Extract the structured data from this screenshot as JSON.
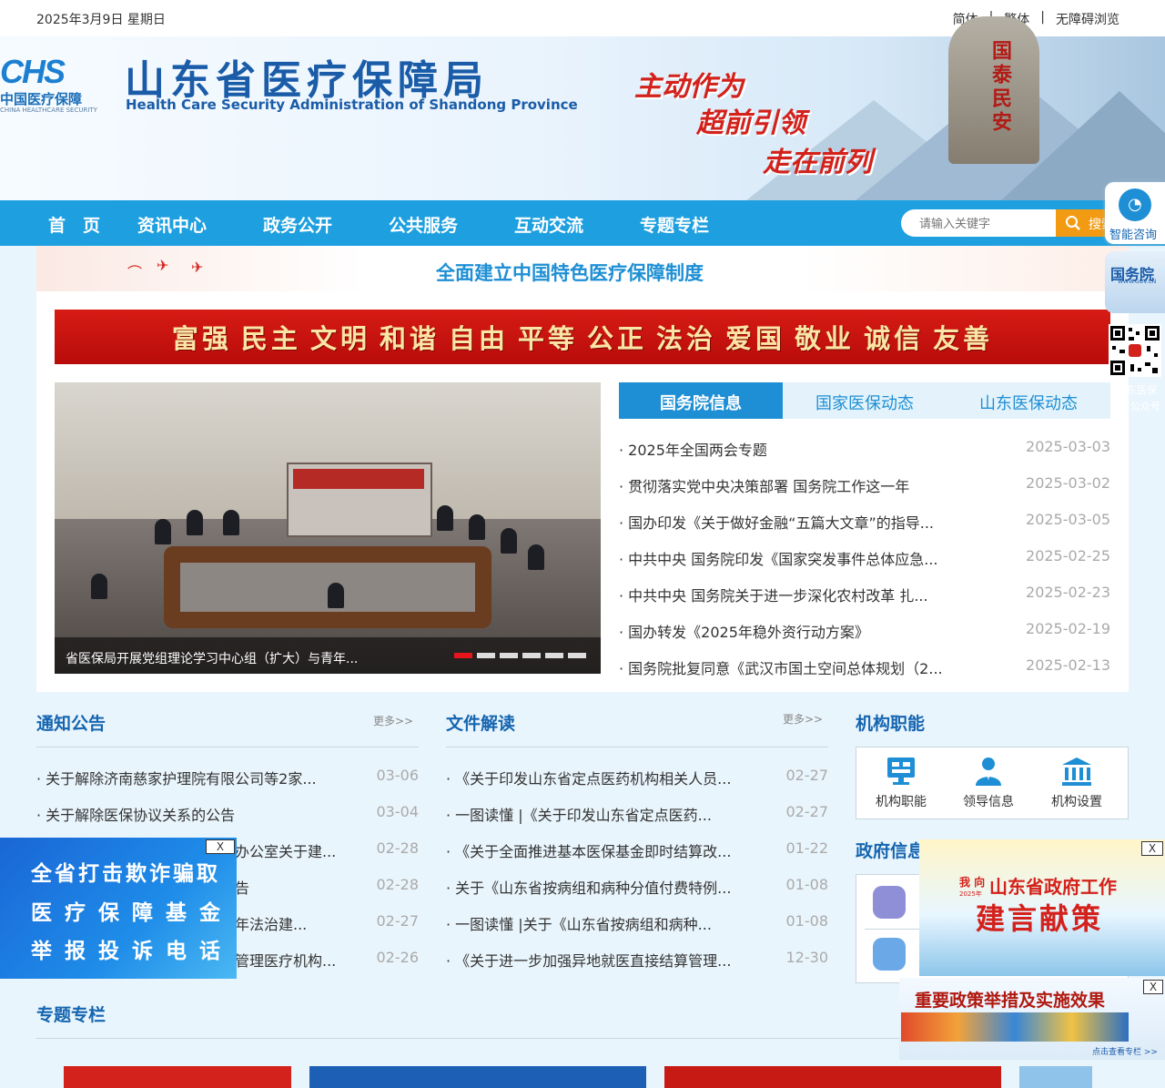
{
  "topbar": {
    "date": "2025年3月9日 星期日",
    "links": [
      "简体",
      "繁体",
      "无障碍浏览"
    ]
  },
  "header": {
    "logo_mark": "CHS",
    "logo_cn": "中国医疗保障",
    "logo_en": "CHINA HEALTHCARE SECURITY",
    "site_title": "山东省医疗保障局",
    "site_subtitle": "Health Care Security Administration of Shandong Province",
    "slogans": [
      "主动作为",
      "超前引领",
      "走在前列"
    ],
    "rock_text": "国泰民安"
  },
  "nav": {
    "items": [
      "首　页",
      "资讯中心",
      "政务公开",
      "公共服务",
      "互动交流",
      "专题专栏"
    ],
    "search_placeholder": "请输入关键字",
    "search_button": "搜索"
  },
  "strip_text": "全面建立中国特色医疗保障制度",
  "core_values": [
    "富强",
    "民主",
    "文明",
    "和谐",
    "自由",
    "平等",
    "公正",
    "法治",
    "爱国",
    "敬业",
    "诚信",
    "友善"
  ],
  "slideshow": {
    "caption": "省医保局开展党组理论学习中心组（扩大）与青年...",
    "slide_count": 6,
    "active_slide": 1
  },
  "news_tabs": {
    "tabs": [
      "国务院信息",
      "国家医保动态",
      "山东医保动态"
    ],
    "active": 0,
    "items": [
      {
        "title": "2025年全国两会专题",
        "date": "2025-03-03"
      },
      {
        "title": "贯彻落实党中央决策部署 国务院工作这一年",
        "date": "2025-03-02"
      },
      {
        "title": "国办印发《关于做好金融“五篇大文章”的指导...",
        "date": "2025-03-05"
      },
      {
        "title": "中共中央 国务院印发《国家突发事件总体应急...",
        "date": "2025-02-25"
      },
      {
        "title": "中共中央 国务院关于进一步深化农村改革 扎...",
        "date": "2025-02-23"
      },
      {
        "title": "国办转发《2025年稳外资行动方案》",
        "date": "2025-02-19"
      },
      {
        "title": "国务院批复同意《武汉市国土空间总体规划（2...",
        "date": "2025-02-13"
      }
    ]
  },
  "notices": {
    "title": "通知公告",
    "more": "更多>>",
    "items": [
      {
        "title": "关于解除济南慈家护理院有限公司等2家...",
        "date": "03-06"
      },
      {
        "title": "关于解除医保协议关系的公告",
        "date": "03-04"
      },
      {
        "title": "办公室关于建...",
        "date": "02-28"
      },
      {
        "title": "告",
        "date": "02-28"
      },
      {
        "title": "年法治建...",
        "date": "02-27"
      },
      {
        "title": "管理医疗机构...",
        "date": "02-26"
      }
    ]
  },
  "documents": {
    "title": "文件解读",
    "more": "更多>>",
    "items": [
      {
        "title": "《关于印发山东省定点医药机构相关人员...",
        "date": "02-27"
      },
      {
        "title": "一图读懂 |《关于印发山东省定点医药...",
        "date": "02-27"
      },
      {
        "title": "《关于全面推进基本医保基金即时结算改...",
        "date": "01-22"
      },
      {
        "title": "关于《山东省按病组和病种分值付费特例...",
        "date": "01-08"
      },
      {
        "title": "一图读懂 |关于《山东省按病组和病种...",
        "date": "01-08"
      },
      {
        "title": "《关于进一步加强异地就医直接结算管理...",
        "date": "12-30"
      }
    ]
  },
  "organization": {
    "title": "机构职能",
    "items": [
      {
        "label": "机构职能",
        "icon": "monitor-icon"
      },
      {
        "label": "领导信息",
        "icon": "person-icon"
      },
      {
        "label": "机构设置",
        "icon": "building-icon"
      }
    ]
  },
  "gov_info": {
    "title": "政府信息"
  },
  "special": {
    "title": "专题专栏"
  },
  "side_float": {
    "assistant": "智能咨询",
    "gov": "国务院",
    "gov_sub": "WWW.GOV.CN",
    "qr_label_1": "东医保",
    "qr_label_2": "公众号"
  },
  "ad_left": {
    "lines": [
      "全省打击欺诈骗取",
      "医 疗 保 障 基 金",
      "举 报 投 诉 电 话"
    ],
    "close": "X"
  },
  "ad_right_1": {
    "prefix": "我 向",
    "year": "2025年",
    "title": "山东省政府工作",
    "subtitle": "建言献策",
    "close": "X"
  },
  "ad_right_2": {
    "title": "重要政策举措及实施效果",
    "link": "点击查看专栏 >>",
    "close": "X"
  },
  "colors": {
    "nav": "#1ea0e0",
    "title_blue": "#1565b0",
    "red": "#d3211b",
    "accent_orange": "#f29b12"
  }
}
